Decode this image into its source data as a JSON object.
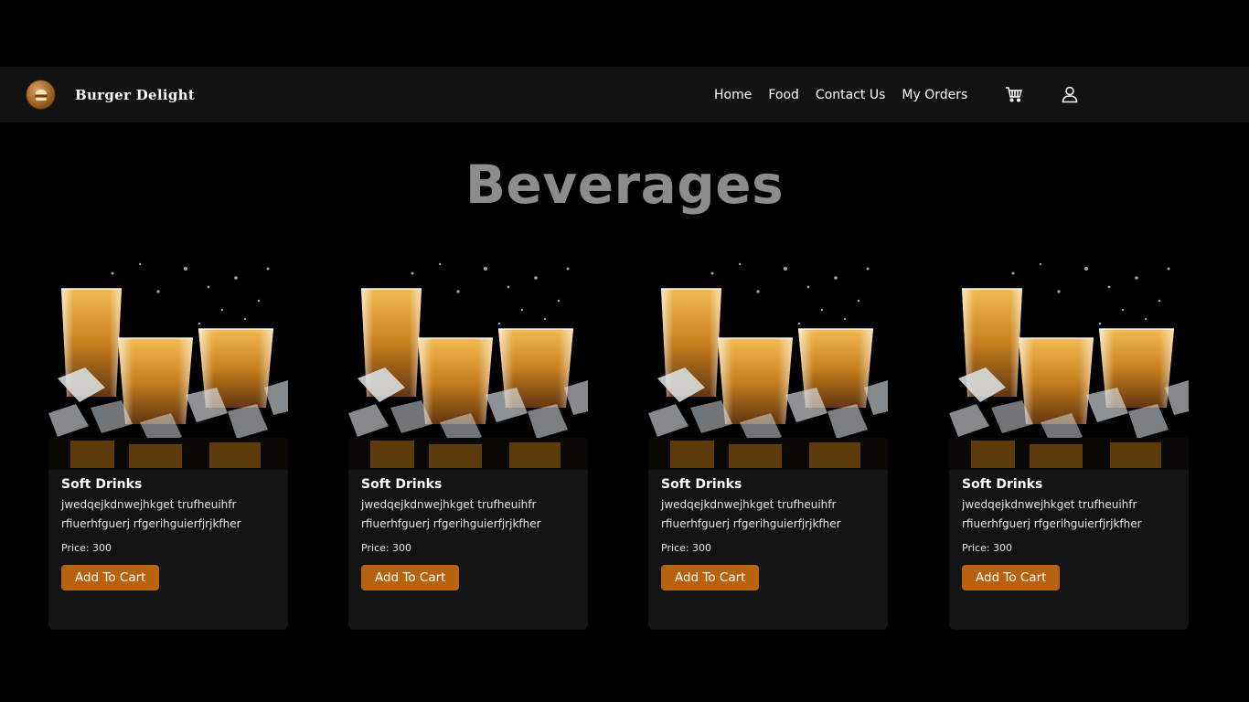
{
  "header": {
    "brand": "Burger Delight",
    "logo_icon": "burger-icon",
    "nav": [
      "Home",
      "Food",
      "Contact Us",
      "My Orders"
    ],
    "cart_icon": "cart-icon",
    "user_icon": "user-icon"
  },
  "page": {
    "title": "Beverages"
  },
  "products": [
    {
      "name": "Soft Drinks",
      "description": "jwedqejkdnwejhkget trufheuihfr rfiuerhfguerj rfgerihguierfjrjkfher",
      "price": "Price: 300",
      "button": "Add To Cart"
    },
    {
      "name": "Soft Drinks",
      "description": "jwedqejkdnwejhkget trufheuihfr rfiuerhfguerj rfgerihguierfjrjkfher",
      "price": "Price: 300",
      "button": "Add To Cart"
    },
    {
      "name": "Soft Drinks",
      "description": "jwedqejkdnwejhkget trufheuihfr rfiuerhfguerj rfgerihguierfjrjkfher",
      "price": "Price: 300",
      "button": "Add To Cart"
    },
    {
      "name": "Soft Drinks",
      "description": "jwedqejkdnwejhkget trufheuihfr rfiuerhfguerj rfgerihguierfjrjkfher",
      "price": "Price: 300",
      "button": "Add To Cart"
    }
  ],
  "colors": {
    "background": "#000000",
    "navbar": "#121212",
    "card": "#131313",
    "accent": "#b8620f",
    "title": "#8c8c8c"
  }
}
